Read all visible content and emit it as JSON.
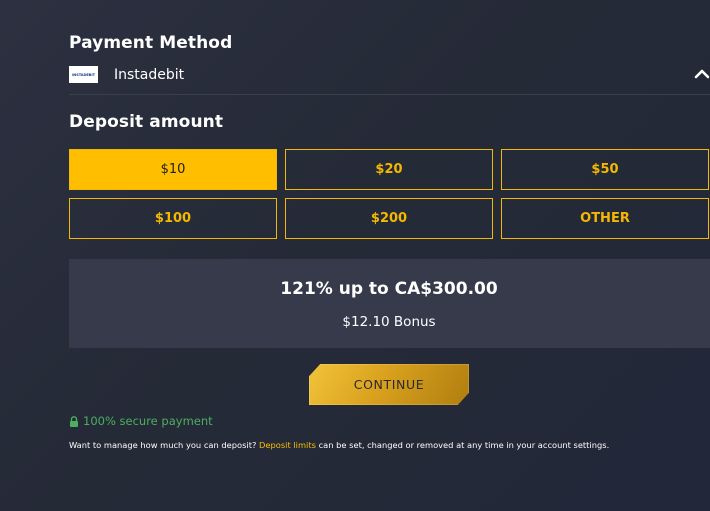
{
  "payment_method": {
    "title": "Payment Method",
    "selected_method": "Instadebit",
    "logo_text": "INSTADEBIT",
    "chevron_icon": "chevron-up-icon"
  },
  "deposit": {
    "title": "Deposit amount",
    "options": [
      "$10",
      "$20",
      "$50",
      "$100",
      "$200",
      "OTHER"
    ],
    "selected": "$10"
  },
  "bonus": {
    "headline": "121% up to CA$300.00",
    "amount": "$12.10 Bonus"
  },
  "continue_label": "CONTINUE",
  "secure": {
    "icon": "lock-icon",
    "text": "100% secure payment"
  },
  "note": {
    "before_link": "Want to manage how much you can deposit? ",
    "link_text": "Deposit limits",
    "after_link": " can be set, changed or removed at any time in your account settings."
  },
  "colors": {
    "accent": "#ffbe00",
    "background": "#262b38",
    "bonus_box": "#363a4b",
    "secure_green": "#4caf5f"
  }
}
